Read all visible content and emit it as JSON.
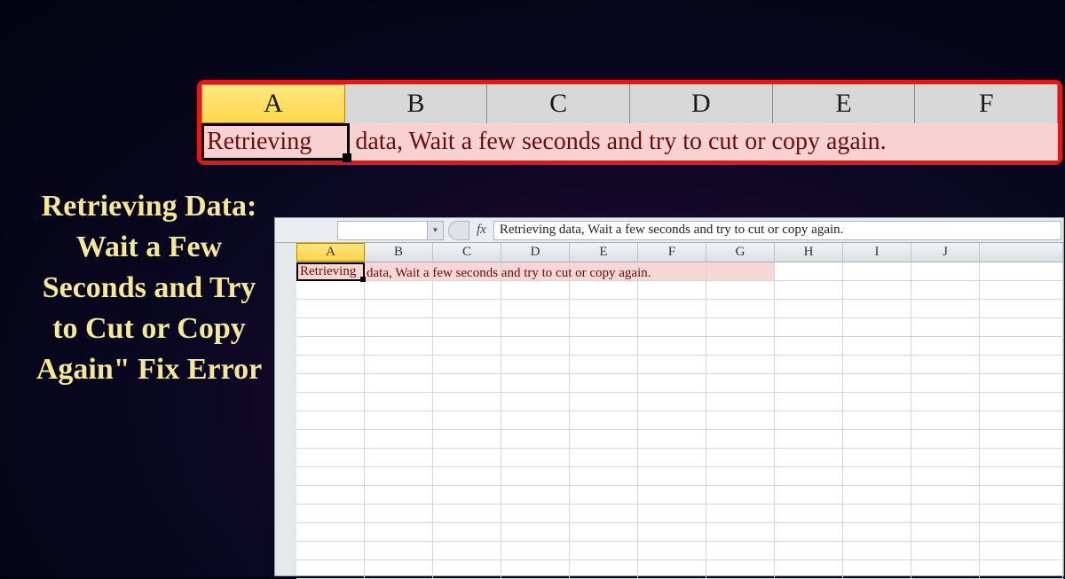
{
  "top_banner": {
    "headers": [
      "A",
      "B",
      "C",
      "D",
      "E",
      "F"
    ],
    "cell_a_text": "Retrieving",
    "rest_text": "data, Wait a few seconds and try to cut or copy again."
  },
  "left_caption": "Retrieving Data: Wait a Few Seconds and Try to Cut or Copy Again\" Fix Error",
  "excel": {
    "fx_label": "fx",
    "formula_text": "Retrieving data, Wait a few seconds and try to cut or copy again.",
    "columns": [
      "A",
      "B",
      "C",
      "D",
      "E",
      "F",
      "G",
      "H",
      "I",
      "J"
    ],
    "selected_column": "A",
    "a1_text": "Retrieving",
    "b1_overflow": "data, Wait a few seconds and try to cut or copy again.",
    "pink_through_col_index": 6,
    "row_count": 17
  },
  "colors": {
    "highlight_red": "#e01818",
    "accent_yellow": "#f4e79a",
    "error_pink": "#f7d6d6",
    "selected_gold": "#ffd84a"
  }
}
